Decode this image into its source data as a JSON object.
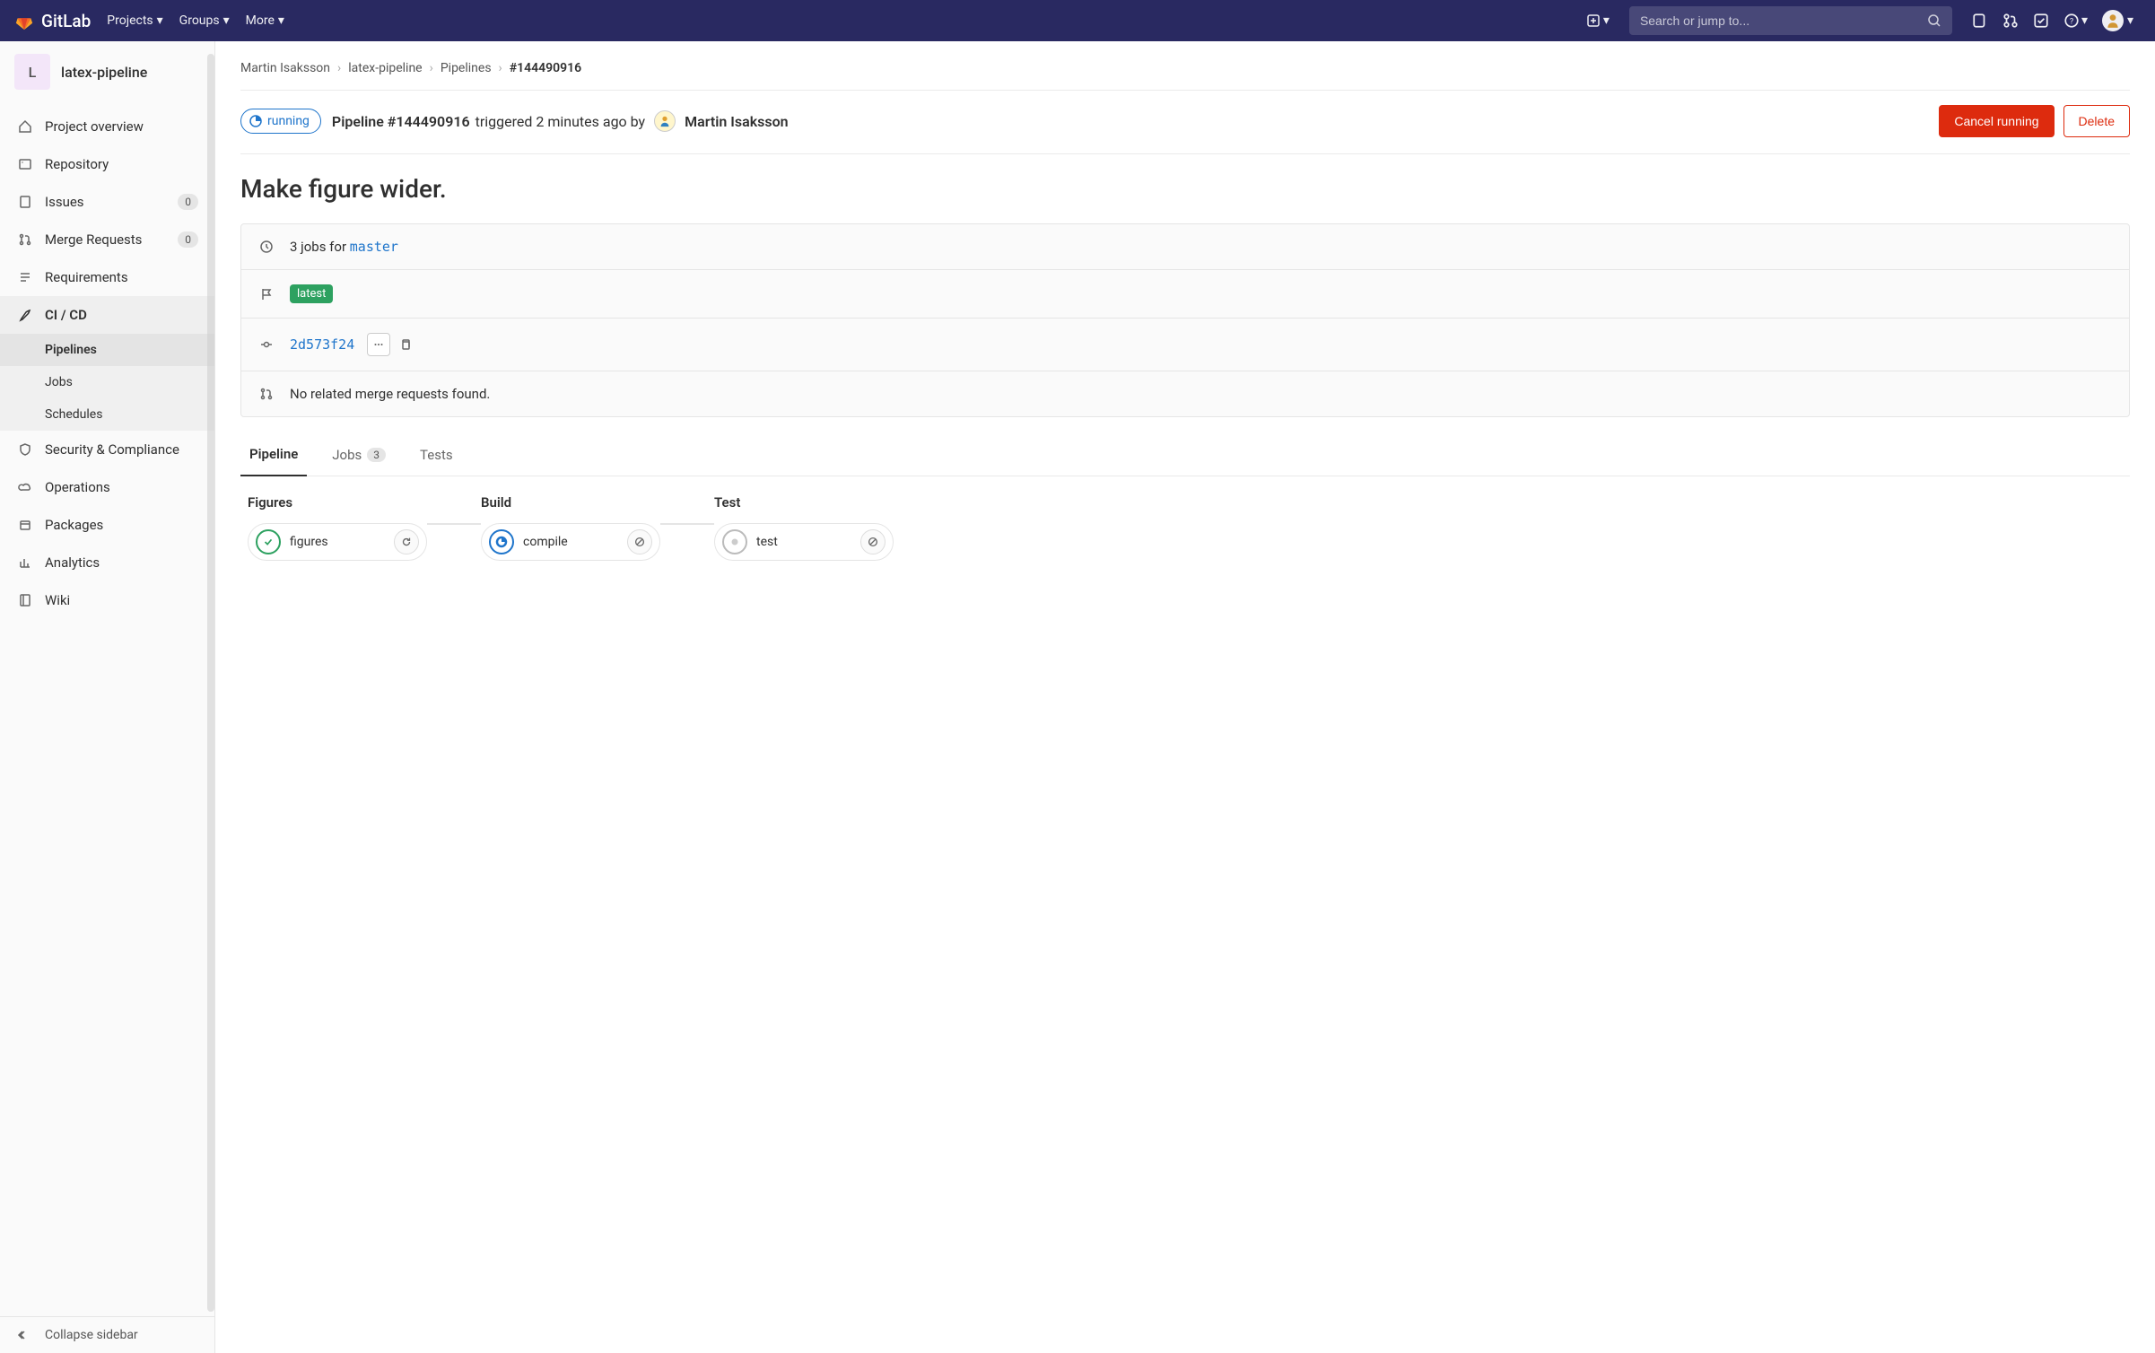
{
  "brand": "GitLab",
  "topnav": {
    "links": [
      "Projects",
      "Groups",
      "More"
    ],
    "search_placeholder": "Search or jump to..."
  },
  "project": {
    "icon_letter": "L",
    "name": "latex-pipeline"
  },
  "sidebar": {
    "items": [
      {
        "label": "Project overview"
      },
      {
        "label": "Repository"
      },
      {
        "label": "Issues",
        "badge": "0"
      },
      {
        "label": "Merge Requests",
        "badge": "0"
      },
      {
        "label": "Requirements"
      },
      {
        "label": "CI / CD",
        "active": true,
        "sub": [
          {
            "label": "Pipelines",
            "active": true
          },
          {
            "label": "Jobs"
          },
          {
            "label": "Schedules"
          }
        ]
      },
      {
        "label": "Security & Compliance"
      },
      {
        "label": "Operations"
      },
      {
        "label": "Packages"
      },
      {
        "label": "Analytics"
      },
      {
        "label": "Wiki"
      }
    ],
    "collapse_label": "Collapse sidebar"
  },
  "breadcrumb": [
    "Martin Isaksson",
    "latex-pipeline",
    "Pipelines",
    "#144490916"
  ],
  "header": {
    "status": "running",
    "pipeline_label": "Pipeline #144490916",
    "trigger_text": "triggered 2 minutes ago by",
    "author": "Martin Isaksson",
    "cancel_label": "Cancel running",
    "delete_label": "Delete"
  },
  "commit_title": "Make figure wider.",
  "info": {
    "jobs_text_prefix": "3 jobs for",
    "branch": "master",
    "latest_tag": "latest",
    "sha": "2d573f24",
    "mr_text": "No related merge requests found."
  },
  "tabs": {
    "pipeline": "Pipeline",
    "jobs": "Jobs",
    "jobs_count": "3",
    "tests": "Tests"
  },
  "stages": [
    {
      "title": "Figures",
      "job": "figures",
      "status": "success",
      "action": "retry"
    },
    {
      "title": "Build",
      "job": "compile",
      "status": "running",
      "action": "cancel"
    },
    {
      "title": "Test",
      "job": "test",
      "status": "pending",
      "action": "cancel"
    }
  ]
}
